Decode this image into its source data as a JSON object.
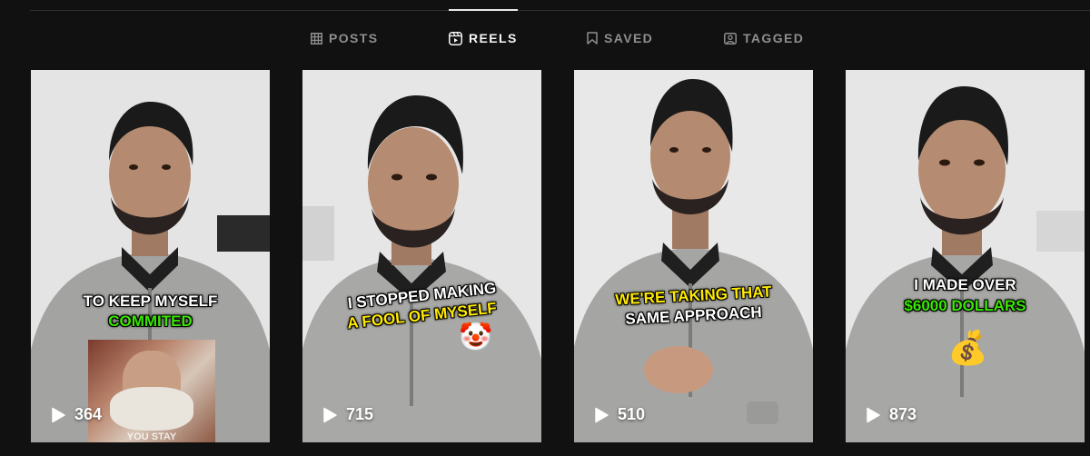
{
  "tabs": [
    {
      "label": "POSTS",
      "icon": "grid-icon",
      "active": false
    },
    {
      "label": "REELS",
      "icon": "reels-icon",
      "active": true
    },
    {
      "label": "SAVED",
      "icon": "bookmark-icon",
      "active": false
    },
    {
      "label": "TAGGED",
      "icon": "tagged-icon",
      "active": false
    }
  ],
  "reels": [
    {
      "caption_line1": "TO KEEP MYSELF",
      "caption_line2": "COMMITED",
      "views": "364",
      "inset_text": "YOU STAY"
    },
    {
      "caption_line1": "I STOPPED MAKING",
      "caption_line2": "A FOOL OF MYSELF",
      "views": "715",
      "emoji": "🤡"
    },
    {
      "caption_line1": "WE'RE TAKING THAT",
      "caption_line2": "SAME APPROACH",
      "views": "510"
    },
    {
      "caption_line1": "I MADE OVER",
      "caption_line2": "$6000 DOLLARS",
      "views": "873",
      "emoji": "💰"
    }
  ],
  "colors": {
    "background": "#111111",
    "tab_inactive": "#8e8e8e",
    "tab_active": "#f5f5f5",
    "caption_green": "#39e600",
    "caption_yellow": "#ffea00"
  }
}
